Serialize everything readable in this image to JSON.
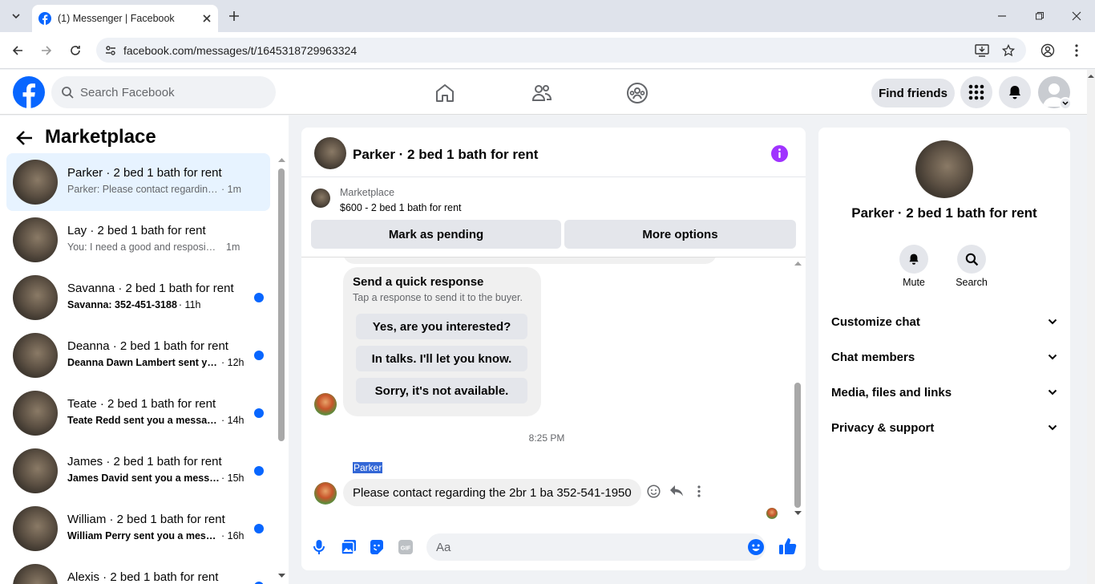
{
  "browser": {
    "tab_title": "(1) Messenger | Facebook",
    "url": "facebook.com/messages/t/1645318729963324"
  },
  "header": {
    "search_placeholder": "Search Facebook",
    "find_friends": "Find friends"
  },
  "sidebar": {
    "title": "Marketplace",
    "conversations": [
      {
        "name": "Parker · 2 bed 1 bath for rent",
        "preview": "Parker: Please contact regarding th...",
        "time": "· 1m",
        "unread": false,
        "selected": true
      },
      {
        "name": "Lay · 2 bed 1 bath for rent",
        "preview": "You: I need a good and resposible ...",
        "time": "1m",
        "unread": false,
        "selected": false
      },
      {
        "name": "Savanna · 2 bed 1 bath for rent",
        "preview": "Savanna: 352-451-3188",
        "time": "· 11h",
        "unread": true,
        "selected": false
      },
      {
        "name": "Deanna · 2 bed 1 bath for rent",
        "preview": "Deanna Dawn Lambert sent yo...",
        "time": "· 12h",
        "unread": true,
        "selected": false
      },
      {
        "name": "Teate · 2 bed 1 bath for rent",
        "preview": "Teate Redd sent you a messag...",
        "time": "· 14h",
        "unread": true,
        "selected": false
      },
      {
        "name": "James · 2 bed 1 bath for rent",
        "preview": "James David sent you a messa...",
        "time": "· 15h",
        "unread": true,
        "selected": false
      },
      {
        "name": "William · 2 bed 1 bath for rent",
        "preview": "William Perry sent you a messa...",
        "time": "· 16h",
        "unread": true,
        "selected": false
      },
      {
        "name": "Alexis · 2 bed 1 bath for rent",
        "preview": "",
        "time": "",
        "unread": true,
        "selected": false
      }
    ]
  },
  "chat": {
    "title": "Parker · 2 bed 1 bath for rent",
    "listing_label": "Marketplace",
    "listing_title": "$600 - 2 bed 1 bath for rent",
    "mark_pending": "Mark as pending",
    "more_options": "More options",
    "quick_response": {
      "title": "Send a quick response",
      "subtitle": "Tap a response to send it to the buyer.",
      "options": [
        "Yes, are you interested?",
        "In talks. I'll let you know.",
        "Sorry, it's not available."
      ]
    },
    "timestamp": "8:25 PM",
    "sender_name": "Parker",
    "message": "Please contact regarding the 2br 1 ba 352-541-1950",
    "input_placeholder": "Aa"
  },
  "info_panel": {
    "name": "Parker · 2 bed 1 bath for rent",
    "mute_label": "Mute",
    "search_label": "Search",
    "sections": [
      "Customize chat",
      "Chat members",
      "Media, files and links",
      "Privacy & support"
    ]
  },
  "colors": {
    "accent": "#0866ff",
    "purple": "#a033ff",
    "selected_bg": "#e7f3ff"
  }
}
